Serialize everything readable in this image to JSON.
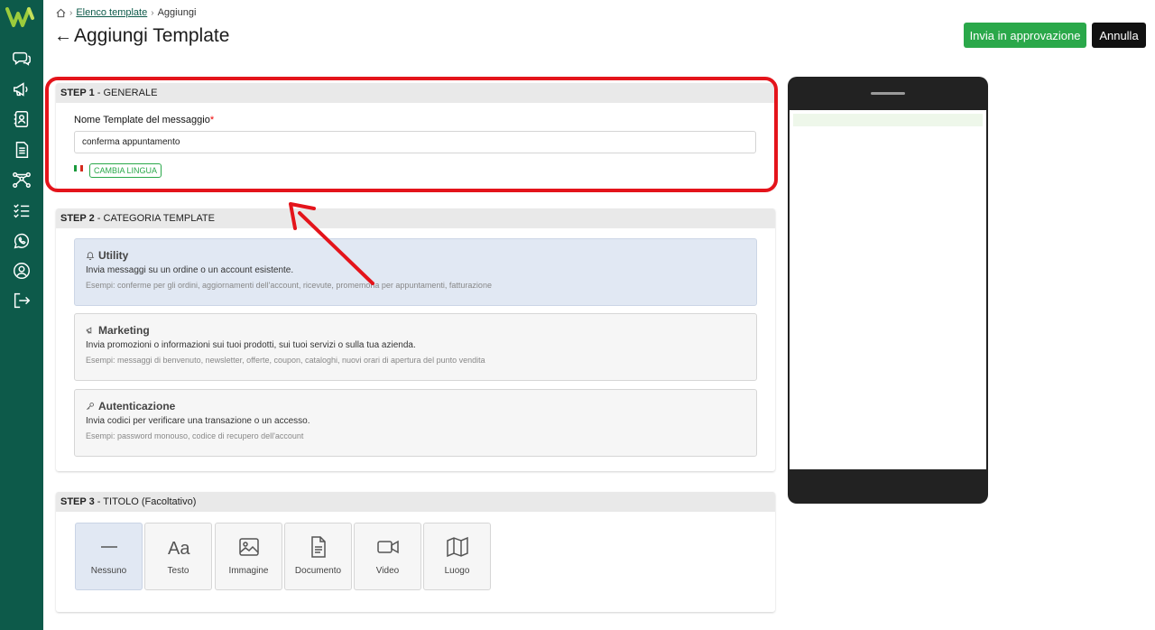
{
  "breadcrumb": {
    "link": "Elenco template",
    "current": "Aggiungi"
  },
  "page": {
    "title": "Aggiungi Template",
    "back_arrow": "←"
  },
  "actions": {
    "approve_label": "Invia in approvazione",
    "cancel_label": "Annulla"
  },
  "sidebar": {
    "icons": [
      "chat-icon",
      "megaphone-icon",
      "contacts-icon",
      "document-icon",
      "flow-icon",
      "checklist-icon",
      "whatsapp-icon",
      "user-icon",
      "logout-icon"
    ]
  },
  "step1": {
    "step": "STEP 1",
    "title": " - GENERALE",
    "field_label": "Nome Template del messaggio",
    "required_mark": "*",
    "field_value": "conferma appuntamento",
    "language_button": "CAMBIA LINGUA"
  },
  "step2": {
    "step": "STEP 2",
    "title": " - CATEGORIA TEMPLATE",
    "options": [
      {
        "title": "Utility",
        "desc": "Invia messaggi su un ordine o un account esistente.",
        "example": "Esempi: conferme per gli ordini, aggiornamenti dell'account, ricevute, promemoria per appuntamenti, fatturazione",
        "selected": true
      },
      {
        "title": "Marketing",
        "desc": "Invia promozioni o informazioni sui tuoi prodotti, sui tuoi servizi o sulla tua azienda.",
        "example": "Esempi: messaggi di benvenuto, newsletter, offerte, coupon, cataloghi, nuovi orari di apertura del punto vendita",
        "selected": false
      },
      {
        "title": "Autenticazione",
        "desc": "Invia codici per verificare una transazione o un accesso.",
        "example": "Esempi: password monouso, codice di recupero dell'account",
        "selected": false
      }
    ]
  },
  "step3": {
    "step": "STEP 3",
    "title": " - TITOLO (Facoltativo)",
    "tiles": [
      "Nessuno",
      "Testo",
      "Immagine",
      "Documento",
      "Video",
      "Luogo"
    ]
  },
  "colors": {
    "sidebar": "#0d5a4a",
    "accent_green": "#2aa84a",
    "highlight_red": "#e4141b"
  }
}
